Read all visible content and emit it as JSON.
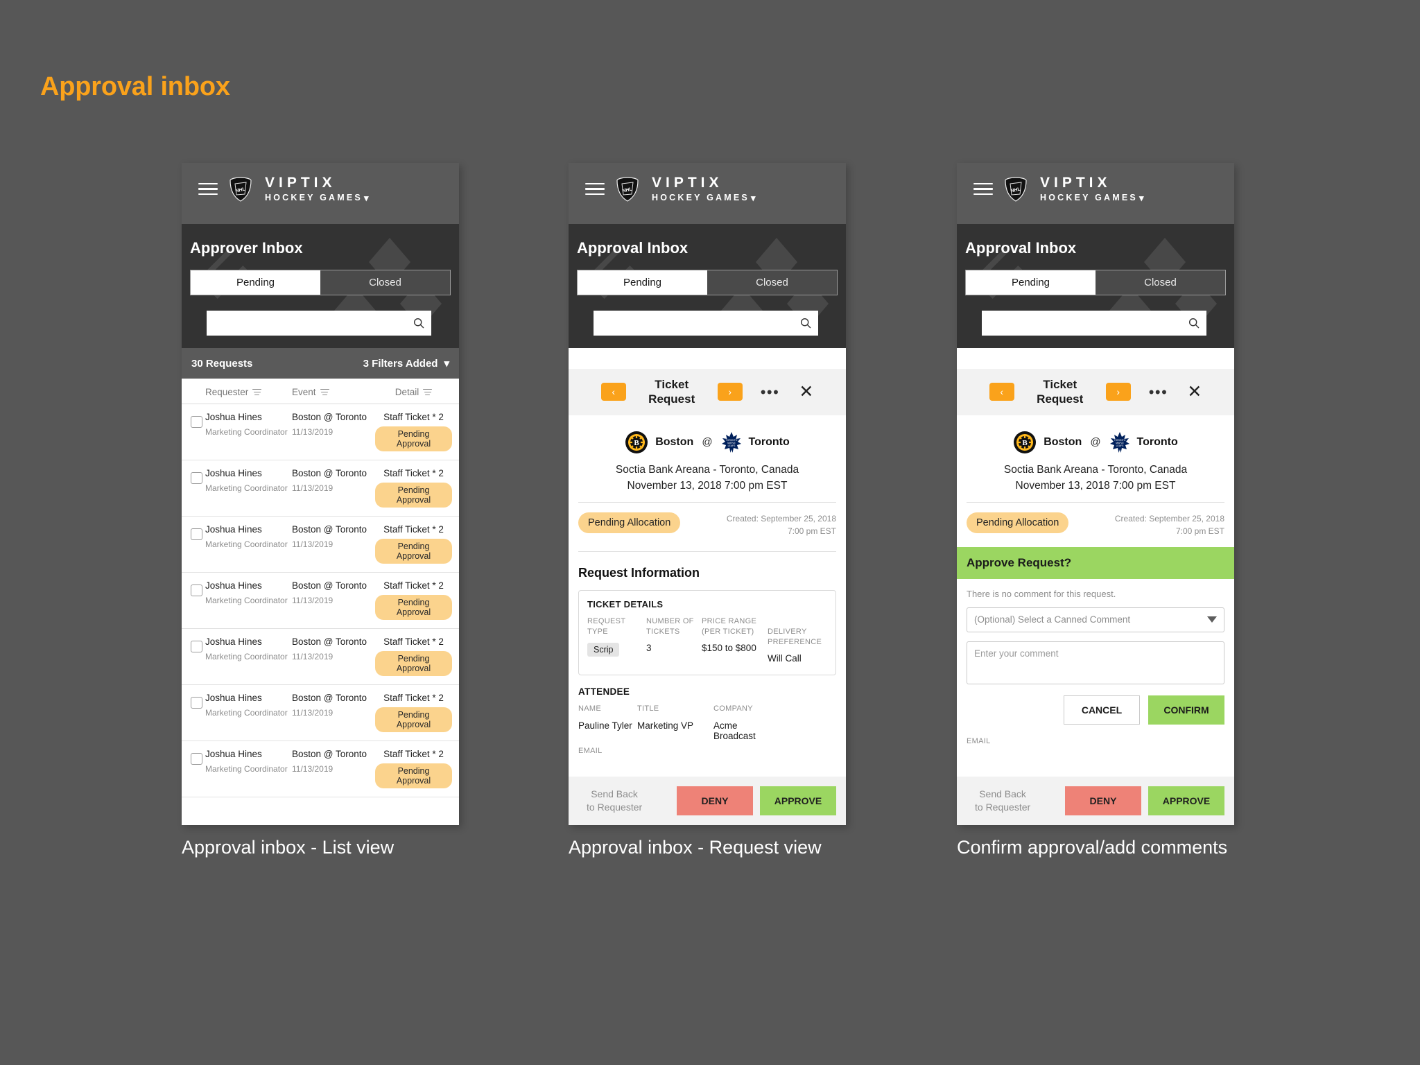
{
  "page": {
    "title": "Approval inbox",
    "accent": "#FAA21B"
  },
  "brand": {
    "name": "VIPTIX",
    "sub": "HOCKEY GAMES",
    "logo": "nhl-shield-icon"
  },
  "screens": [
    {
      "id": "list",
      "sub_title": "Approver Inbox",
      "tabs": {
        "pending": "Pending",
        "closed": "Closed",
        "active": "Pending"
      },
      "search_placeholder": "",
      "count_label": "30 Requests",
      "filters_label": "3 Filters Added",
      "columns": [
        "Requester",
        "Event",
        "Detail"
      ],
      "rows": [
        {
          "name": "Joshua Hines",
          "role": "Marketing Coordinator",
          "event": "Boston @ Toronto",
          "date": "11/13/2019",
          "detail": "Staff Ticket * 2",
          "status": "Pending Approval"
        },
        {
          "name": "Joshua Hines",
          "role": "Marketing Coordinator",
          "event": "Boston @ Toronto",
          "date": "11/13/2019",
          "detail": "Staff Ticket * 2",
          "status": "Pending Approval"
        },
        {
          "name": "Joshua Hines",
          "role": "Marketing Coordinator",
          "event": "Boston @ Toronto",
          "date": "11/13/2019",
          "detail": "Staff Ticket * 2",
          "status": "Pending Approval"
        },
        {
          "name": "Joshua Hines",
          "role": "Marketing Coordinator",
          "event": "Boston @ Toronto",
          "date": "11/13/2019",
          "detail": "Staff Ticket * 2",
          "status": "Pending Approval"
        },
        {
          "name": "Joshua Hines",
          "role": "Marketing Coordinator",
          "event": "Boston @ Toronto",
          "date": "11/13/2019",
          "detail": "Staff Ticket * 2",
          "status": "Pending Approval"
        },
        {
          "name": "Joshua Hines",
          "role": "Marketing Coordinator",
          "event": "Boston @ Toronto",
          "date": "11/13/2019",
          "detail": "Staff Ticket * 2",
          "status": "Pending Approval"
        },
        {
          "name": "Joshua Hines",
          "role": "Marketing Coordinator",
          "event": "Boston @ Toronto",
          "date": "11/13/2019",
          "detail": "Staff Ticket * 2",
          "status": "Pending Approval"
        }
      ],
      "caption": "Approval inbox - List view"
    },
    {
      "id": "request",
      "sub_title": "Approval Inbox",
      "tabs": {
        "pending": "Pending",
        "closed": "Closed",
        "active": "Pending"
      },
      "caption": "Approval inbox - Request view"
    },
    {
      "id": "confirm",
      "sub_title": "Approval Inbox",
      "tabs": {
        "pending": "Pending",
        "closed": "Closed",
        "active": "Pending"
      },
      "caption": "Confirm approval/add comments"
    }
  ],
  "request_view": {
    "toolbar": {
      "title": "Ticket Request",
      "prev": "‹",
      "next": "›",
      "more": "•••",
      "close": "✕"
    },
    "event": {
      "away_team": "Boston",
      "at": "@",
      "home_team": "Toronto",
      "venue": "Soctia Bank Areana - Toronto, Canada",
      "datetime": "November 13, 2018 7:00 pm EST",
      "status_badge": "Pending Allocation",
      "created_line1": "Created: September 25, 2018",
      "created_line2": "7:00 pm EST"
    },
    "section_title": "Request Information",
    "ticket_details": {
      "card_title": "TICKET DETAILS",
      "labels": [
        "REQUEST TYPE",
        "NUMBER OF TICKETS",
        "PRICE RANGE (PER TICKET)",
        "DELIVERY PREFERENCE"
      ],
      "label_request_type_l1": "REQUEST",
      "label_request_type_l2": "TYPE",
      "label_num_l1": "NUMBER OF",
      "label_num_l2": "TICKETS",
      "label_price_l1": "PRICE RANGE",
      "label_price_l2": "(PER TICKET)",
      "label_delivery": "DELIVERY PREFERENCE",
      "request_type": "Scrip",
      "number_of_tickets": "3",
      "price_range": "$150 to $800",
      "delivery_preference": "Will Call"
    },
    "attendee": {
      "heading": "ATTENDEE",
      "label_name": "NAME",
      "label_title": "TITLE",
      "label_company": "COMPANY",
      "name": "Pauline Tyler",
      "title": "Marketing VP",
      "company_l1": "Acme",
      "company_l2": "Broadcast",
      "label_email": "EMAIL"
    },
    "actions": {
      "send_back_l1": "Send Back",
      "send_back_l2": "to Requester",
      "deny": "DENY",
      "approve": "APPROVE"
    }
  },
  "approve_dialog": {
    "heading": "Approve Request?",
    "no_comment": "There is no comment for this request.",
    "canned_select": "(Optional) Select a Canned Comment",
    "comment_placeholder": "Enter your comment",
    "cancel": "CANCEL",
    "confirm": "CONFIRM"
  },
  "colors": {
    "accent_orange": "#FAA21B",
    "badge_amber": "#FBD38D",
    "green": "#9BD661",
    "red": "#EE8277",
    "header_dark": "#333333",
    "bg": "#575757"
  }
}
